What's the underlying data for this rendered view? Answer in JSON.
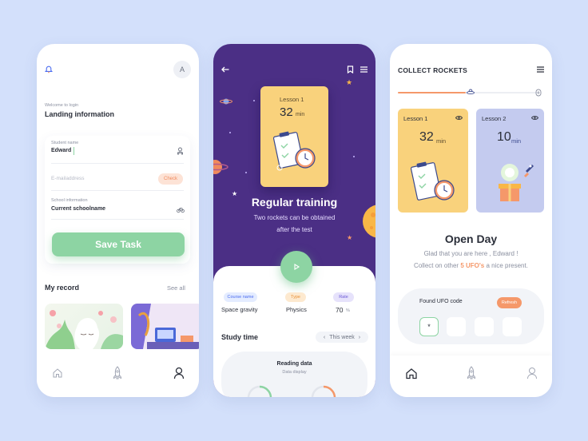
{
  "screen1": {
    "welcome": "Welcome to login",
    "title": "Landing information",
    "avatar_letter": "A",
    "student_label": "Student name",
    "student_value": "Edward",
    "email_placeholder": "E-mailaddress",
    "check_label": "Check",
    "school_label": "School information",
    "school_value": "Current schoolname",
    "save_label": "Save Task",
    "record_title": "My record",
    "see_all": "See all"
  },
  "screen2": {
    "lesson_label": "Lesson 1",
    "lesson_minutes": "32",
    "minutes_unit": "min",
    "title": "Regular training",
    "subtitle_line1": "Two rockets can be obtained",
    "subtitle_line2": "after the test",
    "tags": [
      {
        "label": "Course name",
        "value": "Space gravity"
      },
      {
        "label": "Type",
        "value": "Physics"
      },
      {
        "label": "Rate",
        "value": "70",
        "unit": "%"
      }
    ],
    "study_time": "Study time",
    "week_label": "This week",
    "reading_title": "Reading data",
    "reading_sub": "Data display"
  },
  "screen3": {
    "header": "COLLECT ROCKETS",
    "lesson1_label": "Lesson 1",
    "lesson1_minutes": "32",
    "lesson2_label": "Lesson 2",
    "lesson2_minutes": "10",
    "minutes_unit": "min",
    "title": "Open Day",
    "line1": "Glad that you are here , Edward !",
    "line2_before": "Collect on other ",
    "line2_highlight": "5 UFO's",
    "line2_after": " a nice present.",
    "found_label": "Found UFO code",
    "refresh_label": "Refresh",
    "code_first": "*"
  },
  "colors": {
    "background": "#d3e0fb",
    "purple": "#4b2f85",
    "green": "#8dd4a3",
    "yellow_card": "#f9d27c",
    "blue_card": "#c4cbef",
    "orange": "#f5986a"
  }
}
